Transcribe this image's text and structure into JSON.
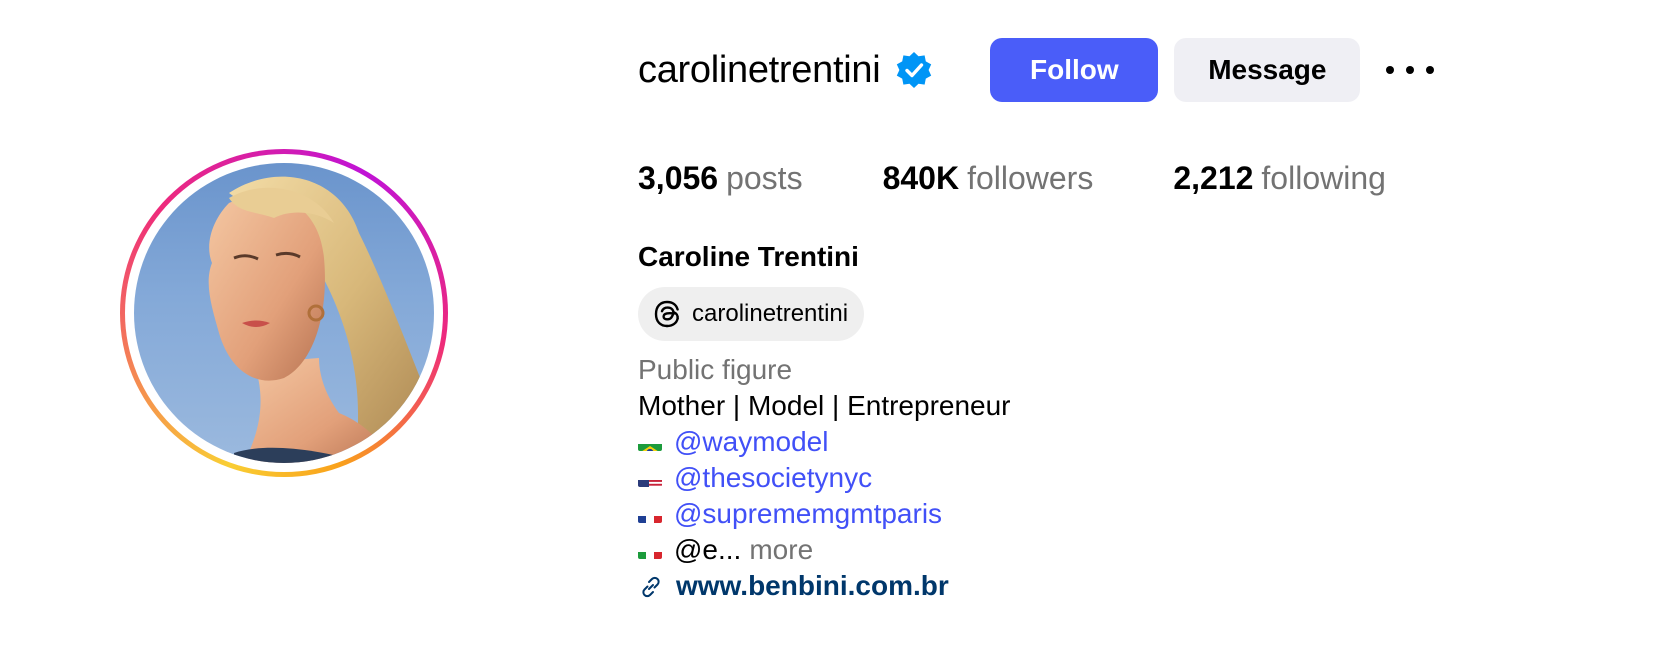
{
  "profile": {
    "username": "carolinetrentini",
    "verified_icon": "verified-badge-icon",
    "full_name": "Caroline Trentini",
    "avatar_icon": "profile-photo",
    "accent_color": "#4a5df9"
  },
  "actions": {
    "follow_label": "Follow",
    "message_label": "Message",
    "more_icon": "ellipsis-icon"
  },
  "stats": {
    "posts_value": "3,056",
    "posts_label": "posts",
    "followers_value": "840K",
    "followers_label": "followers",
    "following_value": "2,212",
    "following_label": "following"
  },
  "threads": {
    "icon": "threads-icon",
    "handle": "carolinetrentini"
  },
  "bio": {
    "category": "Public figure",
    "tagline": "Mother | Model | Entrepreneur",
    "agencies": [
      {
        "flag": "brazil-flag-icon",
        "handle": "@waymodel"
      },
      {
        "flag": "usa-flag-icon",
        "handle": "@thesocietynyc"
      },
      {
        "flag": "france-flag-icon",
        "handle": "@suprememgmtparis"
      },
      {
        "flag": "italy-flag-icon",
        "handle": "@e..."
      }
    ],
    "more_label": "more",
    "website_icon": "link-icon",
    "website": "www.benbini.com.br"
  }
}
